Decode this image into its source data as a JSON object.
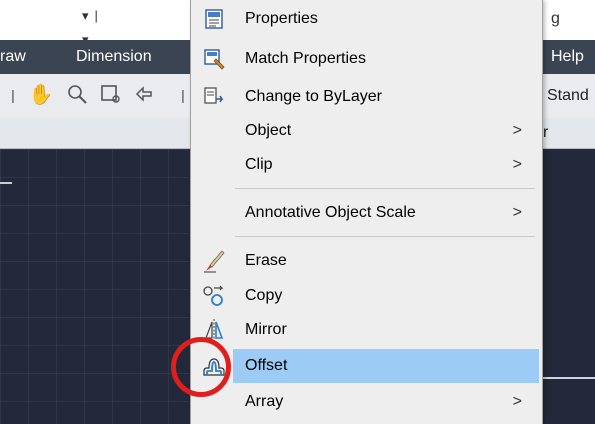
{
  "app": {
    "qa_dropdown_glyph": "▾|▾",
    "right_title_fragment": "g",
    "menubar": {
      "draw_fragment": "raw",
      "dimension": "Dimension",
      "help": "Help"
    },
    "toolbar": {
      "right_fragment": "Stand"
    },
    "strip_right_fragment": "r"
  },
  "context_menu": {
    "items": [
      {
        "label": "Properties",
        "icon": "properties-icon"
      },
      {
        "label": "Match Properties",
        "icon": "match-properties-icon"
      },
      {
        "label": "Change to ByLayer",
        "icon": "change-bylayer-icon"
      },
      {
        "label": "Object",
        "submenu": ">"
      },
      {
        "label": "Clip",
        "submenu": ">"
      },
      {
        "label": "Annotative Object Scale",
        "submenu": ">"
      },
      {
        "label": "Erase",
        "icon": "erase-icon"
      },
      {
        "label": "Copy",
        "icon": "copy-icon"
      },
      {
        "label": "Mirror",
        "icon": "mirror-icon"
      },
      {
        "label": "Offset",
        "icon": "offset-icon",
        "highlighted": true
      },
      {
        "label": "Array",
        "submenu": ">"
      }
    ]
  },
  "colors": {
    "highlight": "#9ccbf5",
    "annotation_circle": "#e01e1e",
    "canvas": "#23293a",
    "menubar": "#3b4453"
  }
}
